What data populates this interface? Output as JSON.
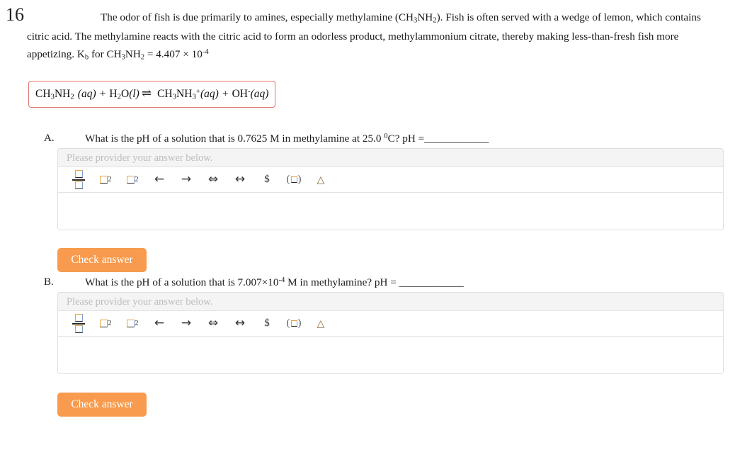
{
  "question": {
    "number": "16",
    "stem_line1_a": "The odor of fish is due primarily to amines, especially methylamine (CH",
    "stem_sub1": "3",
    "stem_line1_b": "NH",
    "stem_sub2": "2",
    "stem_line1_c": "). Fish is often served with a wedge of lemon, which contains citric acid. The methylamine reacts with the citric acid to form an odorless product, methylammonium citrate, thereby making less-than-fresh fish more appetizing. K",
    "kb_sub": "b",
    "stem_line3_a": " for CH",
    "stem_line3_b": "NH",
    "stem_line3_c": " = 4.407 × 10",
    "kb_exponent": "-4",
    "kb_value": "4.407 × 10⁻⁴"
  },
  "equation": {
    "reactant1": "CH",
    "reactant1_sub1": "3",
    "reactant1_mid": "NH",
    "reactant1_sub2": "2",
    "reactant1_state": "(aq)",
    "plus1": "+",
    "reactant2": "H",
    "reactant2_sub": "2",
    "reactant2_mid": "O",
    "reactant2_state": "(l)",
    "arrow": "⇌",
    "product1": "CH",
    "product1_sub1": "3",
    "product1_mid": "NH",
    "product1_sub2": "3",
    "product1_charge": "+",
    "product1_state": "(aq)",
    "plus2": "+",
    "product2": "OH",
    "product2_charge": "-",
    "product2_state": "(aq)",
    "border_color": "#e0726b"
  },
  "parts": [
    {
      "letter": "A.",
      "question_pre": "What is the pH of a solution that is 0.7625 M in methylamine at 25.0 ",
      "question_deg": "0",
      "question_post": "C? pH =",
      "blank": "____________",
      "editor": {
        "placeholder": "Please provider your answer below.",
        "content": ""
      },
      "check_label": "Check answer"
    },
    {
      "letter": "B.",
      "question_pre": "What is the pH of a solution that is 7.007×10",
      "question_exp": "-4",
      "question_post": " M in methylamine? pH = ",
      "blank": "____________",
      "editor": {
        "placeholder": "Please provider your answer below.",
        "content": ""
      },
      "check_label": "Check answer"
    }
  ],
  "toolbar": {
    "items": [
      {
        "name": "fraction-icon",
        "label": "fraction"
      },
      {
        "name": "superscript-icon",
        "label": "superscript",
        "exp": "2"
      },
      {
        "name": "subscript-icon",
        "label": "subscript",
        "exp": "2"
      },
      {
        "name": "arrow-left-icon",
        "label": "←"
      },
      {
        "name": "arrow-right-icon",
        "label": "→"
      },
      {
        "name": "double-arrow-icon",
        "label": "⇔"
      },
      {
        "name": "bidirectional-arrow-icon",
        "label": "↔"
      },
      {
        "name": "dollar-icon",
        "label": "$"
      },
      {
        "name": "parentheses-icon",
        "label": "( )"
      },
      {
        "name": "delta-triangle-icon",
        "label": "△"
      }
    ]
  },
  "colors": {
    "button_orange": "#f89b4e",
    "equation_border": "#e0726b",
    "panel_header_bg": "#f4f4f4",
    "panel_border": "#dedede",
    "placeholder_text": "#bdbdbd"
  }
}
